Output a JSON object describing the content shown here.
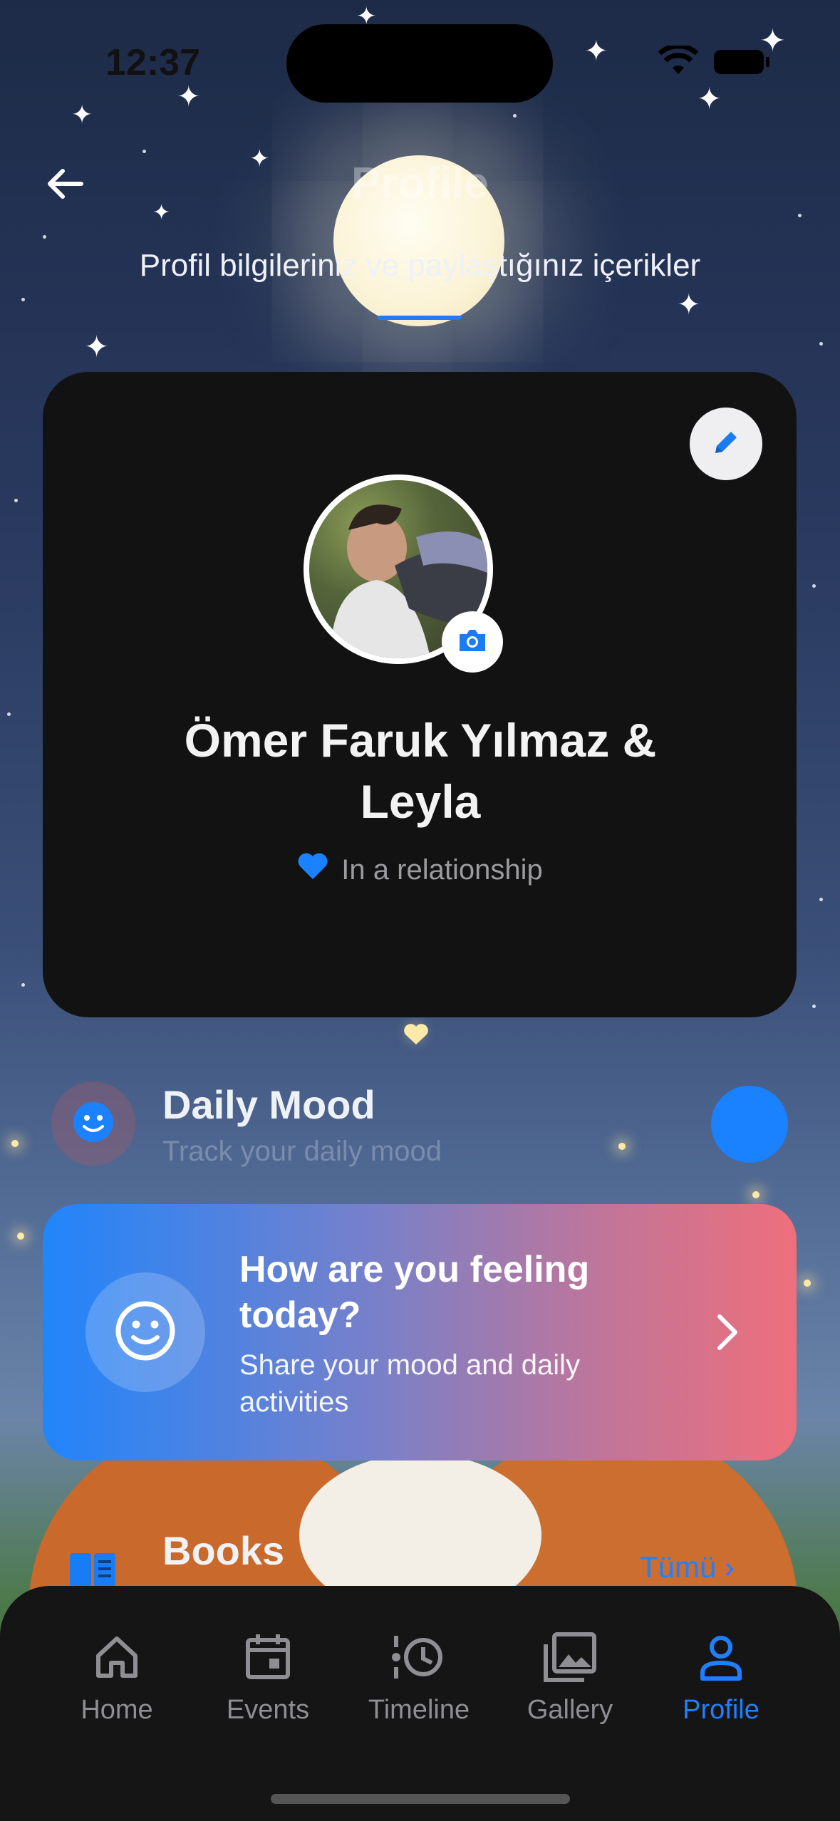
{
  "status_bar": {
    "time": "12:37"
  },
  "header": {
    "title": "Profile",
    "subtitle": "Profil bilgileriniz ve paylaştığınız içerikler"
  },
  "profile": {
    "name": "Ömer Faruk Yılmaz & Leyla",
    "relationship_status": "In a relationship"
  },
  "daily_mood": {
    "title": "Daily Mood",
    "subtitle": "Track your daily mood"
  },
  "feeling_card": {
    "title": "How are you feeling today?",
    "subtitle": "Share your mood and daily activities"
  },
  "books": {
    "title": "Books",
    "see_all": "Tümü"
  },
  "nav": {
    "items": [
      {
        "label": "Home",
        "icon": "home-icon"
      },
      {
        "label": "Events",
        "icon": "calendar-icon"
      },
      {
        "label": "Timeline",
        "icon": "timeline-icon"
      },
      {
        "label": "Gallery",
        "icon": "gallery-icon"
      },
      {
        "label": "Profile",
        "icon": "person-icon"
      }
    ],
    "active": "Profile"
  },
  "colors": {
    "accent": "#1f80ff",
    "card_bg": "#121212",
    "nav_bg": "#151515",
    "gradient_start": "#2185fb",
    "gradient_end": "#ee6f7c"
  }
}
